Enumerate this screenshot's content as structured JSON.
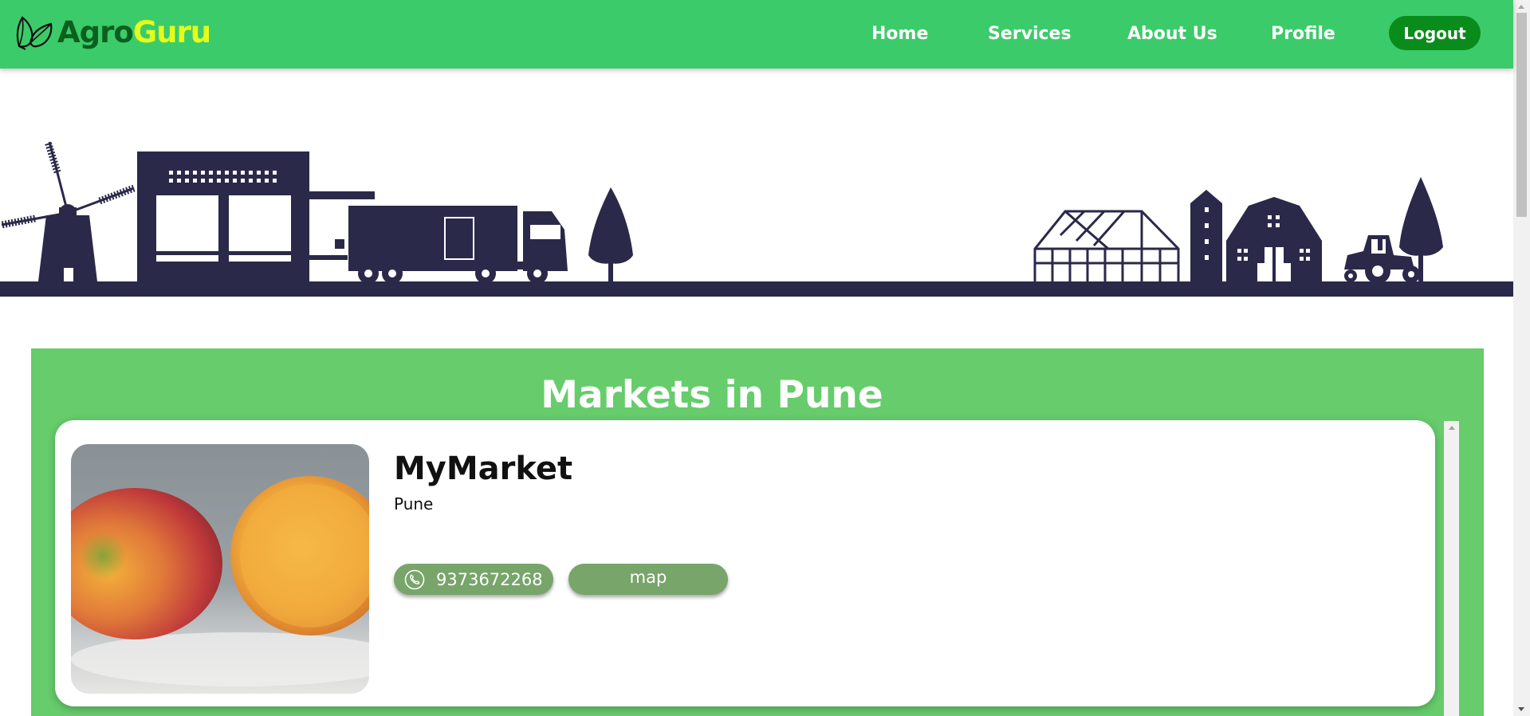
{
  "brand": {
    "part1": "Agro",
    "part2": "Guru"
  },
  "nav": {
    "home": "Home",
    "services": "Services",
    "about": "About Us",
    "profile": "Profile",
    "logout": "Logout"
  },
  "section": {
    "title": "Markets in Pune"
  },
  "markets": [
    {
      "name": "MyMarket",
      "city": "Pune",
      "phone": "9373672268",
      "map_label": "map"
    }
  ],
  "colors": {
    "nav_bg": "#3ccb6a",
    "logout_bg": "#0a8c1c",
    "section_bg": "#66cc6c",
    "button_bg": "#77a56a",
    "silhouette": "#2b2949"
  },
  "icons": {
    "logo": "leaf-icon",
    "phone": "phone-icon",
    "banner": "farm-silhouette-illustration"
  }
}
